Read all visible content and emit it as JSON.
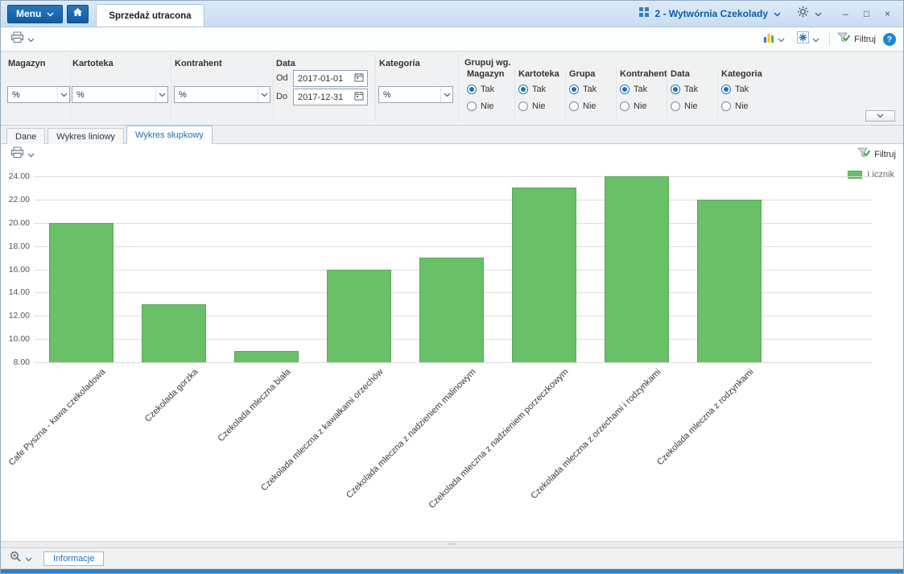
{
  "titlebar": {
    "menu_label": "Menu",
    "tab_label": "Sprzedaż utracona",
    "company_label": "2 - Wytwórnia Czekolady",
    "minimize_glyph": "–",
    "maximize_glyph": "□",
    "close_glyph": "×"
  },
  "toolbar": {
    "filter_label": "Filtruj",
    "help_glyph": "?"
  },
  "filters": {
    "magazyn_label": "Magazyn",
    "magazyn_value": "%",
    "kartoteka_label": "Kartoteka",
    "kartoteka_value": "%",
    "kontrahent_label": "Kontrahent",
    "kontrahent_value": "%",
    "data_label": "Data",
    "od_label": "Od",
    "date_from": "2017-01-01",
    "do_label": "Do",
    "date_to": "2017-12-31",
    "kategoria_label": "Kategoria",
    "kategoria_value": "%",
    "grupuj_label": "Grupuj wg.",
    "yes_label": "Tak",
    "no_label": "Nie",
    "group_options": [
      {
        "name": "magazyn",
        "label": "Magazyn",
        "selected": "Tak"
      },
      {
        "name": "kartoteka",
        "label": "Kartoteka",
        "selected": "Tak"
      },
      {
        "name": "grupa",
        "label": "Grupa",
        "selected": "Tak"
      },
      {
        "name": "kontrahent",
        "label": "Kontrahent",
        "selected": "Tak"
      },
      {
        "name": "data",
        "label": "Data",
        "selected": "Tak"
      },
      {
        "name": "kategoria",
        "label": "Kategoria",
        "selected": "Tak"
      }
    ]
  },
  "view_tabs": [
    {
      "name": "tab-dane",
      "label": "Dane",
      "active": false
    },
    {
      "name": "tab-wykres-liniowy",
      "label": "Wykres liniowy",
      "active": false
    },
    {
      "name": "tab-wykres-slupkowy",
      "label": "Wykres słupkowy",
      "active": true
    }
  ],
  "chart_toolbar": {
    "filter_label": "Filtruj"
  },
  "chart_data": {
    "type": "bar",
    "title": "",
    "categories": [
      "Cafe Pyszna - kawa czekoladowa",
      "Czekolada gorzka",
      "Czekolada mleczna biała",
      "Czekolada mleczna z kawałkami orzechów",
      "Czekolada mleczna z nadzieniem malinowym",
      "Czekolada mleczna z nadzieniem porzeczkowym",
      "Czekolada mleczna z orzechami i rodzynkami",
      "Czekolada mleczna z rodzynkami"
    ],
    "series": [
      {
        "name": "Licznik",
        "values": [
          20,
          13,
          9,
          16,
          17,
          23,
          24,
          22
        ]
      }
    ],
    "xlabel": "",
    "ylabel": "",
    "ylim": [
      8,
      24
    ],
    "ytick_step": 2,
    "grid": true,
    "legend_position": "top-right",
    "bar_color": "#6abf69"
  },
  "bottom": {
    "info_tab_label": "Informacje",
    "grip_glyph": "⋯"
  },
  "colors": {
    "accent_blue": "#0f5ca8",
    "bar_green": "#6abf69",
    "status_strip_blue": "#2e82c4"
  }
}
